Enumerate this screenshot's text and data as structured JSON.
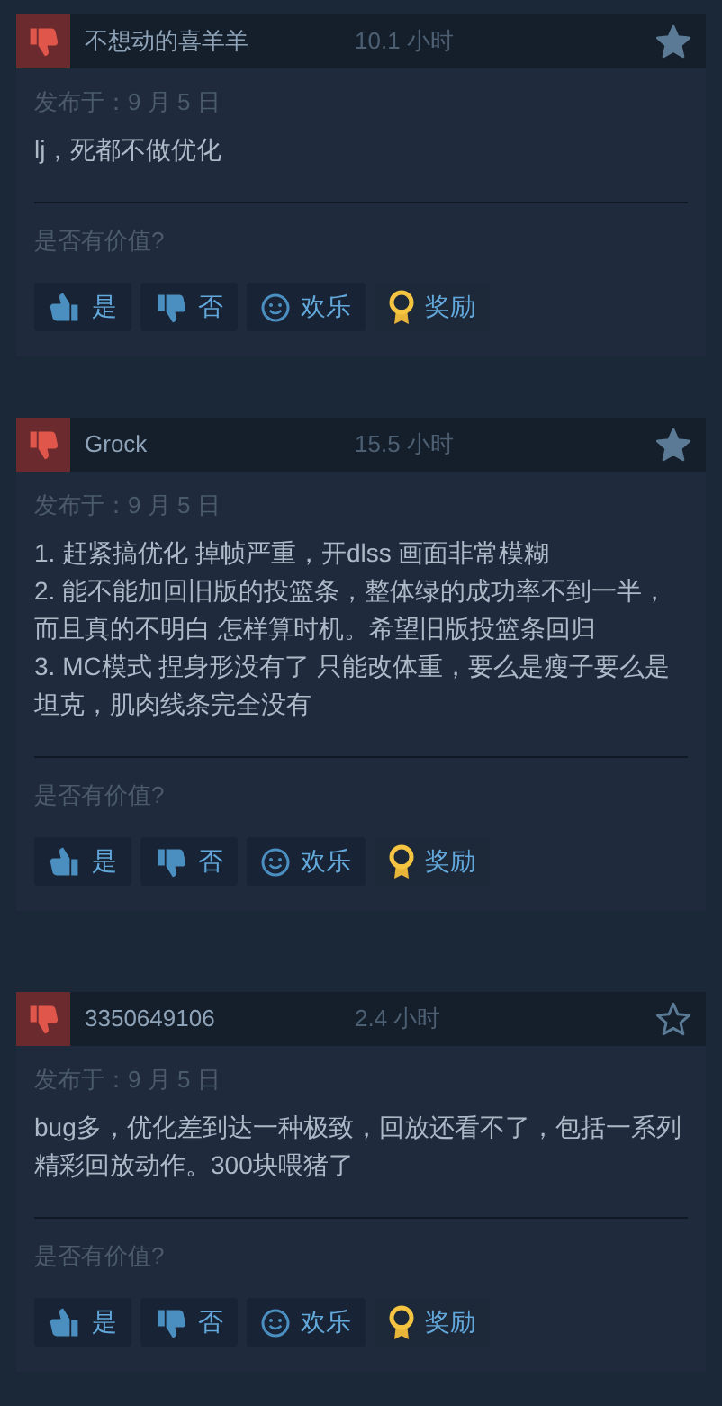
{
  "reviews": [
    {
      "recommended": false,
      "author": "不想动的喜羊羊",
      "hours": "10.1 小时",
      "favorited": true,
      "posted": "发布于：9 月 5 日",
      "paragraphs": [
        "lj，死都不做优化"
      ],
      "question": "是否有价值?",
      "buttons": [
        {
          "kind": "yes",
          "label": "是"
        },
        {
          "kind": "no",
          "label": "否"
        },
        {
          "kind": "funny",
          "label": "欢乐"
        },
        {
          "kind": "award",
          "label": "奖励"
        }
      ]
    },
    {
      "recommended": false,
      "author": "Grock",
      "hours": "15.5 小时",
      "favorited": true,
      "posted": "发布于：9 月 5 日",
      "paragraphs": [
        "1. 赶紧搞优化 掉帧严重，开dlss 画面非常模糊",
        "2. 能不能加回旧版的投篮条，整体绿的成功率不到一半，而且真的不明白 怎样算时机。希望旧版投篮条回归",
        "3. MC模式 捏身形没有了 只能改体重，要么是瘦子要么是坦克，肌肉线条完全没有"
      ],
      "question": "是否有价值?",
      "buttons": [
        {
          "kind": "yes",
          "label": "是"
        },
        {
          "kind": "no",
          "label": "否"
        },
        {
          "kind": "funny",
          "label": "欢乐"
        },
        {
          "kind": "award",
          "label": "奖励"
        }
      ]
    },
    {
      "recommended": false,
      "author": "3350649106",
      "hours": "2.4 小时",
      "favorited": false,
      "posted": "发布于：9 月 5 日",
      "paragraphs": [
        "bug多，优化差到达一种极致，回放还看不了，包括一系列精彩回放动作。300块喂猪了"
      ],
      "question": "是否有价值?",
      "buttons": [
        {
          "kind": "yes",
          "label": "是"
        },
        {
          "kind": "no",
          "label": "否"
        },
        {
          "kind": "funny",
          "label": "欢乐"
        },
        {
          "kind": "award",
          "label": "奖励"
        }
      ]
    }
  ]
}
